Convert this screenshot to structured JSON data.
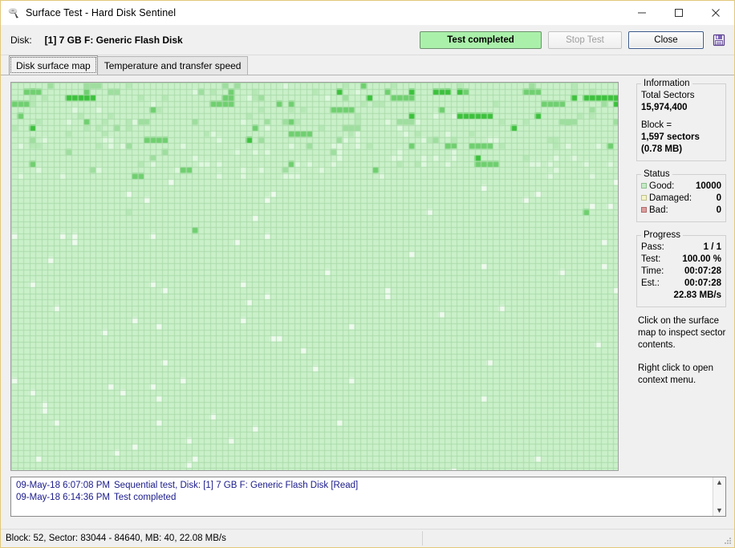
{
  "window": {
    "title": "Surface Test - Hard Disk Sentinel",
    "icon": "surface-test-icon",
    "controls": {
      "minimize": "minimize-icon",
      "maximize": "maximize-icon",
      "close": "close-icon"
    }
  },
  "toolbar": {
    "disk_label": "Disk:",
    "disk_value": "[1] 7 GB F: Generic Flash Disk",
    "status_button": "Test completed",
    "stop_button": "Stop Test",
    "close_button": "Close",
    "save_icon": "save-floppy-icon"
  },
  "tabs": [
    {
      "label": "Disk surface map",
      "active": true
    },
    {
      "label": "Temperature and transfer speed",
      "active": false
    }
  ],
  "information": {
    "legend": "Information",
    "total_sectors_label": "Total Sectors",
    "total_sectors_value": "15,974,400",
    "block_label": "Block =",
    "block_value": "1,597 sectors",
    "block_size": "(0.78 MB)"
  },
  "status": {
    "legend": "Status",
    "rows": [
      {
        "label": "Good:",
        "value": "10000",
        "swatch": "good"
      },
      {
        "label": "Damaged:",
        "value": "0",
        "swatch": "damaged"
      },
      {
        "label": "Bad:",
        "value": "0",
        "swatch": "bad"
      }
    ]
  },
  "progress": {
    "legend": "Progress",
    "rows": [
      {
        "label": "Pass:",
        "value": "1 / 1"
      },
      {
        "label": "Test:",
        "value": "100.00 %"
      },
      {
        "label": "Time:",
        "value": "00:07:28"
      },
      {
        "label": "Est.:",
        "value": "00:07:28"
      }
    ],
    "speed": "22.83 MB/s"
  },
  "hints": {
    "line1": "Click on the surface map to inspect sector contents.",
    "line2": "Right click to open context menu."
  },
  "log": {
    "entries": [
      {
        "time": "09-May-18  6:07:08 PM",
        "text": "Sequential test, Disk: [1] 7 GB F: Generic Flash Disk [Read]"
      },
      {
        "time": "09-May-18  6:14:36 PM",
        "text": "Test completed"
      }
    ],
    "scroll_up": "scroll-up-icon",
    "scroll_down": "scroll-down-icon"
  },
  "statusbar": {
    "text": "Block: 52, Sector: 83044 - 84640, MB: 40, 22.08 MB/s"
  },
  "colors": {
    "good": "#c6ebc6",
    "damaged": "#f4f4c8",
    "bad": "#dd9d9d",
    "status_button_bg": "#aaf0aa",
    "window_border": "#e3c87a",
    "log_text": "#1a1a8c"
  },
  "surface_map": {
    "cols": 101,
    "rows": 64,
    "cell": 7.5,
    "base_color": "#c9f0c9",
    "grid_color": "#a9d9a9",
    "shades": [
      "#c9f0c9",
      "#b6e8b6",
      "#9ede9e",
      "#6fcf6f",
      "#3cc13c",
      "#1fa81f",
      "#dff7df",
      "#eefaee"
    ]
  }
}
